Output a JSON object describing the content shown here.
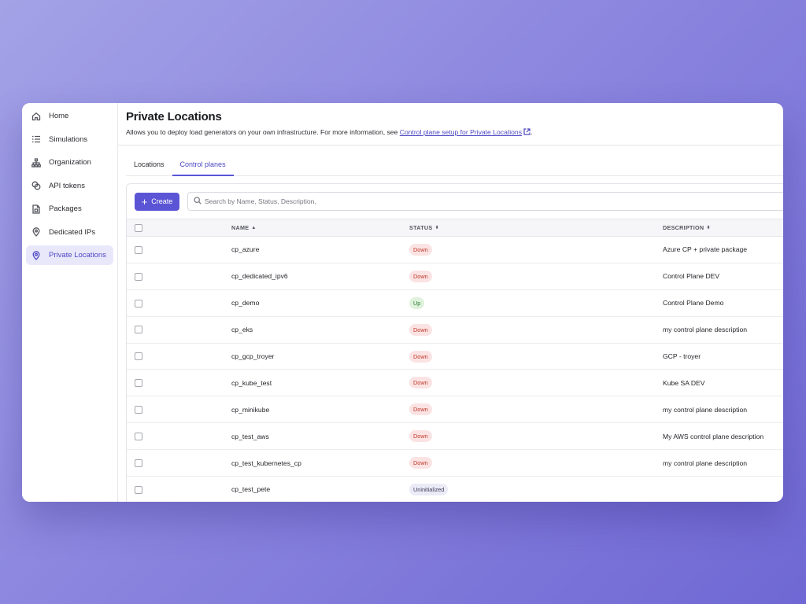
{
  "sidebar": {
    "items": [
      {
        "label": "Home",
        "icon": "home-icon",
        "active": false
      },
      {
        "label": "Simulations",
        "icon": "list-icon",
        "active": false
      },
      {
        "label": "Organization",
        "icon": "org-tree-icon",
        "active": false
      },
      {
        "label": "API tokens",
        "icon": "tokens-icon",
        "active": false
      },
      {
        "label": "Packages",
        "icon": "package-icon",
        "active": false
      },
      {
        "label": "Dedicated IPs",
        "icon": "location-pin-icon",
        "active": false
      },
      {
        "label": "Private Locations",
        "icon": "location-pin-icon",
        "active": true
      }
    ]
  },
  "page": {
    "title": "Private Locations",
    "description": "Allows you to deploy load generators on your own infrastructure. For more information, see ",
    "link_text": "Control plane setup for Private Locations",
    "description_end": "."
  },
  "tabs": [
    {
      "label": "Locations",
      "active": false
    },
    {
      "label": "Control planes",
      "active": true
    }
  ],
  "toolbar": {
    "create_label": "Create",
    "search_placeholder": "Search by Name, Status, Description,"
  },
  "table": {
    "columns": {
      "name": "NAME",
      "status": "STATUS",
      "description": "DESCRIPTION"
    },
    "rows": [
      {
        "name": "cp_azure",
        "status": "Down",
        "description": "Azure CP + private package"
      },
      {
        "name": "cp_dedicated_ipv6",
        "status": "Down",
        "description": "Control Plane DEV"
      },
      {
        "name": "cp_demo",
        "status": "Up",
        "description": "Control Plane Demo"
      },
      {
        "name": "cp_eks",
        "status": "Down",
        "description": "my control plane description"
      },
      {
        "name": "cp_gcp_troyer",
        "status": "Down",
        "description": "GCP - troyer"
      },
      {
        "name": "cp_kube_test",
        "status": "Down",
        "description": "Kube SA DEV"
      },
      {
        "name": "cp_minikube",
        "status": "Down",
        "description": "my control plane description"
      },
      {
        "name": "cp_test_aws",
        "status": "Down",
        "description": "My AWS control plane description"
      },
      {
        "name": "cp_test_kubernetes_cp",
        "status": "Down",
        "description": "my control plane description"
      },
      {
        "name": "cp_test_pete",
        "status": "Uninitialized",
        "description": ""
      }
    ]
  },
  "colors": {
    "accent": "#5b55d6",
    "down": "#c0392b",
    "up": "#2e7d32"
  }
}
